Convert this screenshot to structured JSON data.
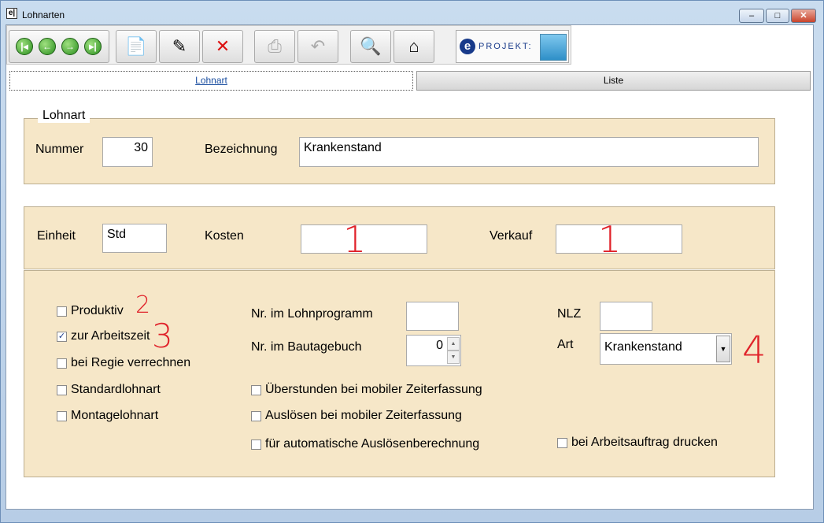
{
  "window": {
    "title": "Lohnarten",
    "app_icon_text": "e|"
  },
  "toolbar": {
    "nav": [
      "first-icon",
      "prev-icon",
      "next-icon",
      "last-icon"
    ],
    "buttons": [
      "new-icon",
      "edit-icon",
      "delete-icon",
      "print-icon",
      "undo-icon",
      "search-icon",
      "home-icon"
    ],
    "logo_text": "PROJEKT:"
  },
  "tabs": {
    "lohnart": "Lohnart",
    "liste": "Liste"
  },
  "group": {
    "legend": "Lohnart"
  },
  "form": {
    "nummer_label": "Nummer",
    "nummer_value": "30",
    "bezeichnung_label": "Bezeichnung",
    "bezeichnung_value": "Krankenstand",
    "einheit_label": "Einheit",
    "einheit_value": "Std",
    "kosten_label": "Kosten",
    "kosten_value": "",
    "verkauf_label": "Verkauf",
    "verkauf_value": "",
    "lohnprogramm_label": "Nr. im Lohnprogramm",
    "lohnprogramm_value": "",
    "bautagebuch_label": "Nr. im Bautagebuch",
    "bautagebuch_value": "0",
    "nlz_label": "NLZ",
    "nlz_value": "",
    "art_label": "Art",
    "art_value": "Krankenstand"
  },
  "checkboxes": {
    "produktiv": "Produktiv",
    "arbeitszeit": "zur Arbeitszeit",
    "regie": "bei Regie verrechnen",
    "standard": "Standardlohnart",
    "montage": "Montagelohnart",
    "ueberstunden": "Überstunden bei mobiler Zeiterfassung",
    "ausloesen": "Auslösen bei mobiler Zeiterfassung",
    "auto_ausloesen": "für automatische Auslösenberechnung",
    "arbeitsauftrag": "bei Arbeitsauftrag drucken"
  },
  "annotations": {
    "a1": "1",
    "a2": "1",
    "a3": "2",
    "a4": "3",
    "a5": "4"
  },
  "colors": {
    "panel": "#f6e7c8",
    "annotation": "#e0222a"
  }
}
